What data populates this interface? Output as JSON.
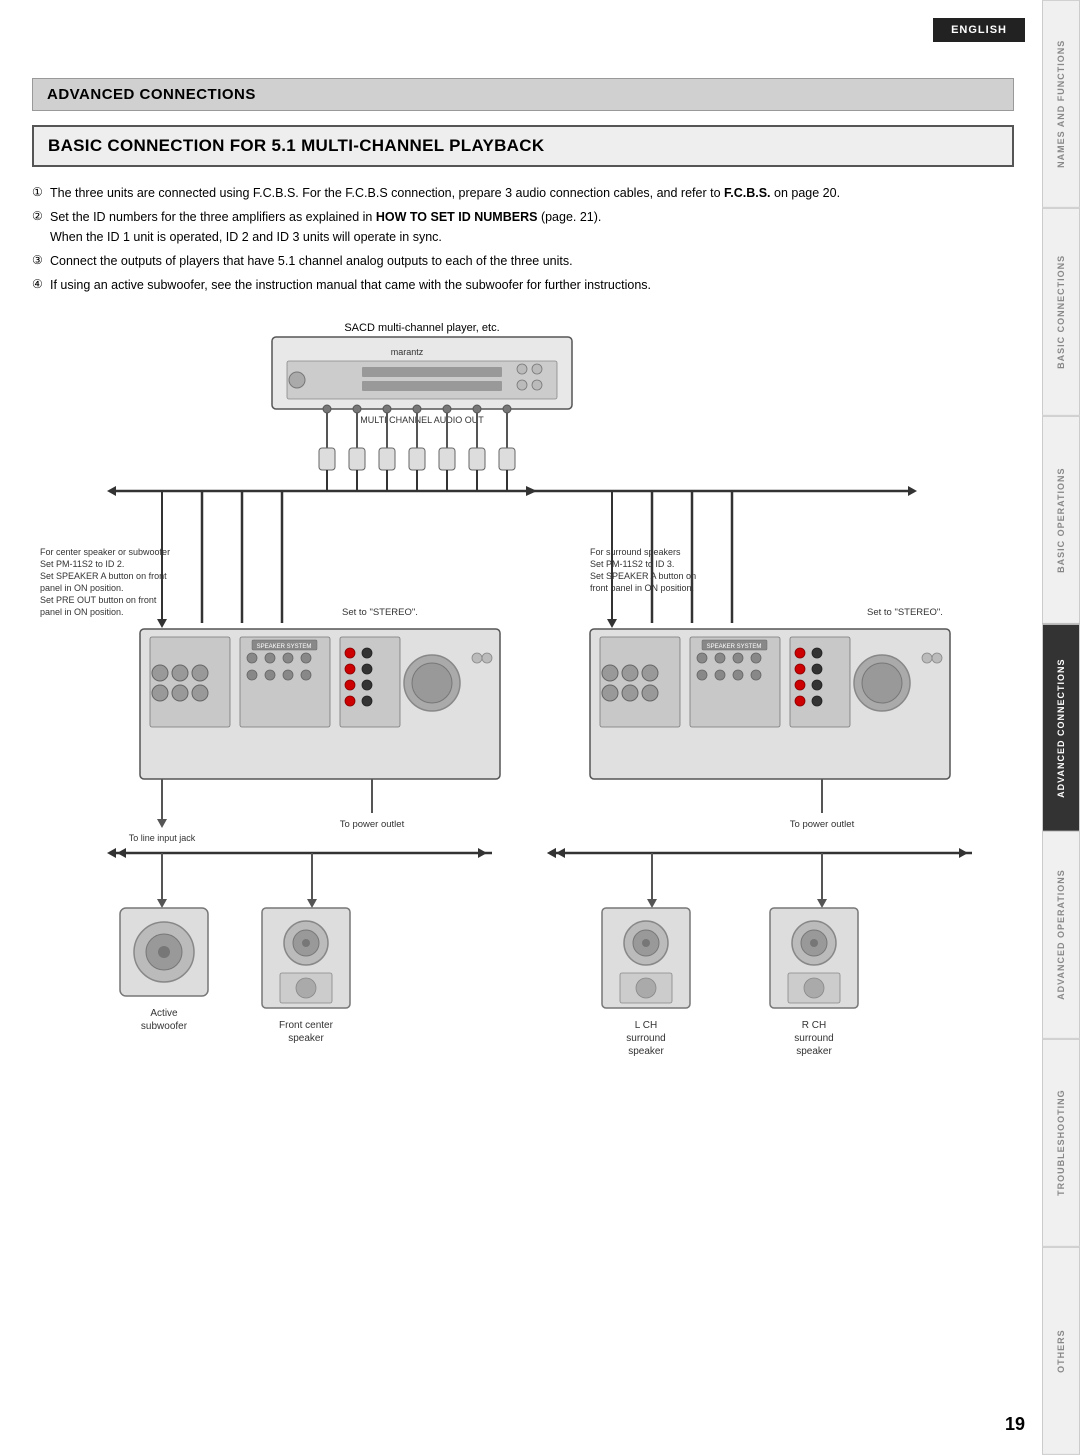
{
  "language_btn": "ENGLISH",
  "page_number": "19",
  "advanced_connections_header": "ADVANCED CONNECTIONS",
  "section_title": "BASIC CONNECTION FOR 5.1 MULTI-CHANNEL PLAYBACK",
  "instructions": [
    {
      "num": "①",
      "text": "The three units are connected using F.C.B.S. For the F.C.B.S connection, prepare 3 audio connection cables, and refer to ",
      "bold": "F.C.B.S.",
      "text2": " on page 20."
    },
    {
      "num": "②",
      "text": "Set the ID numbers for the three amplifiers as explained in ",
      "bold": "HOW TO SET ID NUMBERS",
      "text2": " (page. 21).",
      "subtext": "When the ID 1 unit is operated, ID 2 and ID 3 units will operate in sync."
    },
    {
      "num": "③",
      "text": "Connect the outputs of players that have 5.1 channel analog outputs to each of the three units."
    },
    {
      "num": "④",
      "text": "If using an active subwoofer, see the instruction manual that came with the subwoofer for further instructions."
    }
  ],
  "diagram": {
    "sacd_label": "SACD multi-channel player, etc.",
    "multi_channel_label": "MULTI CHANNEL AUDIO OUT",
    "left_amp": {
      "instructions": [
        "For center speaker or subwoofer",
        "Set PM-11S2 to ID 2.",
        "Set SPEAKER A button on front",
        "panel in ON position.",
        "Set PRE OUT button on front",
        "panel in ON position."
      ],
      "stereo_label": "Set to \"STEREO\".",
      "power_label": "To power outlet",
      "line_input_label": "To line input jack"
    },
    "right_amp": {
      "instructions": [
        "For surround speakers",
        "Set PM-11S2 to ID 3.",
        "Set SPEAKER A button on",
        "front panel in ON position."
      ],
      "stereo_label": "Set to \"STEREO\".",
      "power_label": "To power outlet"
    },
    "speakers": [
      {
        "label": "Active\nsubwoofer"
      },
      {
        "label": "Front center\nspeaker"
      },
      {
        "label": "L CH\nsurround\nspeaker"
      },
      {
        "label": "R CH\nsurround\nspeaker"
      }
    ]
  },
  "sidebar": {
    "tabs": [
      {
        "label": "NAMES AND FUNCTIONS",
        "active": false
      },
      {
        "label": "BASIC CONNECTIONS",
        "active": false
      },
      {
        "label": "BASIC OPERATIONS",
        "active": false
      },
      {
        "label": "ADVANCED CONNECTIONS",
        "active": true
      },
      {
        "label": "ADVANCED OPERATIONS",
        "active": false
      },
      {
        "label": "TROUBLESHOOTING",
        "active": false
      },
      {
        "label": "OTHERS",
        "active": false
      }
    ]
  }
}
